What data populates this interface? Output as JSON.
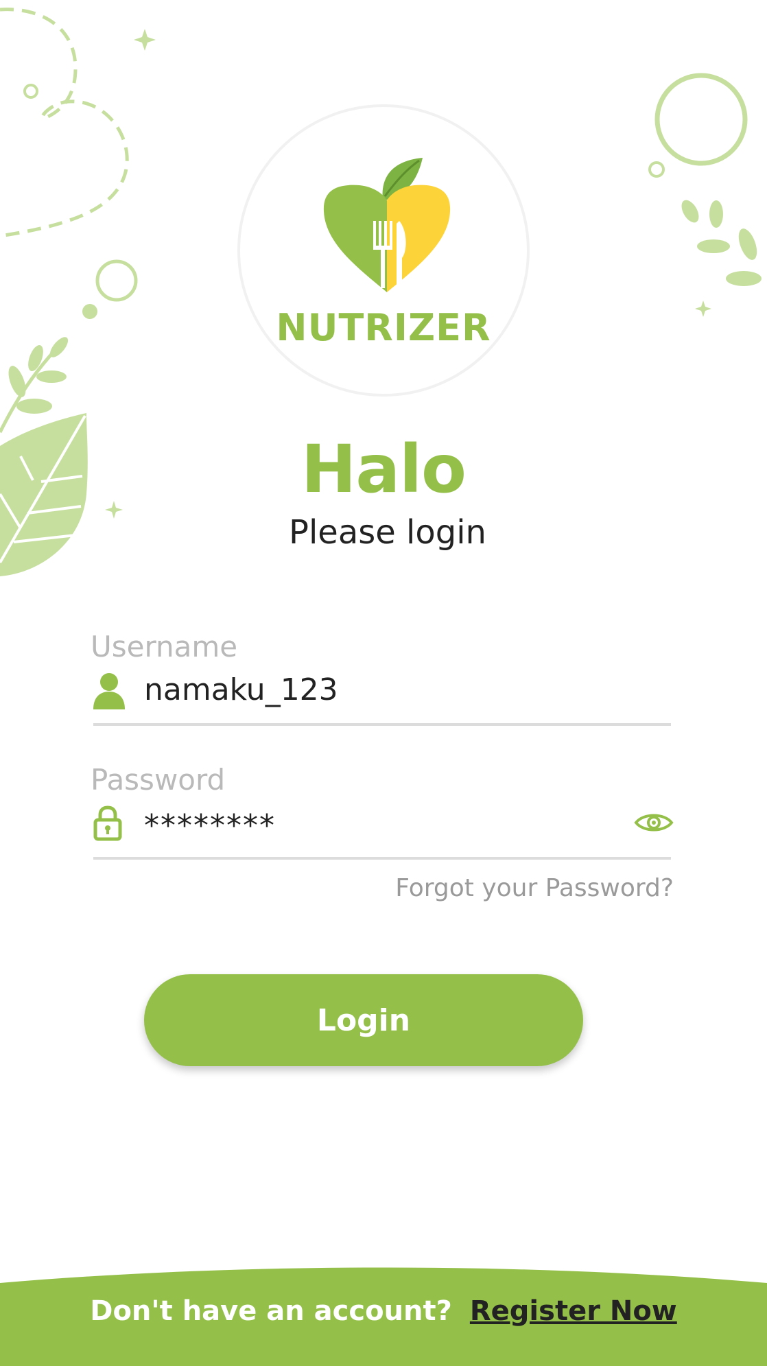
{
  "brand": {
    "name": "NUTRIZER",
    "colors": {
      "green": "#94c04a",
      "yellow": "#fdd33a",
      "leaf": "#7cb342"
    }
  },
  "greeting": {
    "title": "Halo",
    "subtitle": "Please login"
  },
  "form": {
    "username": {
      "label": "Username",
      "value": "namaku_123",
      "icon": "user-icon"
    },
    "password": {
      "label": "Password",
      "value": "********",
      "icon": "lock-icon",
      "toggle_icon": "eye-icon"
    },
    "forgot_label": "Forgot your Password?",
    "login_label": "Login"
  },
  "footer": {
    "question": "Don't have an account?",
    "register_label": "Register Now"
  }
}
